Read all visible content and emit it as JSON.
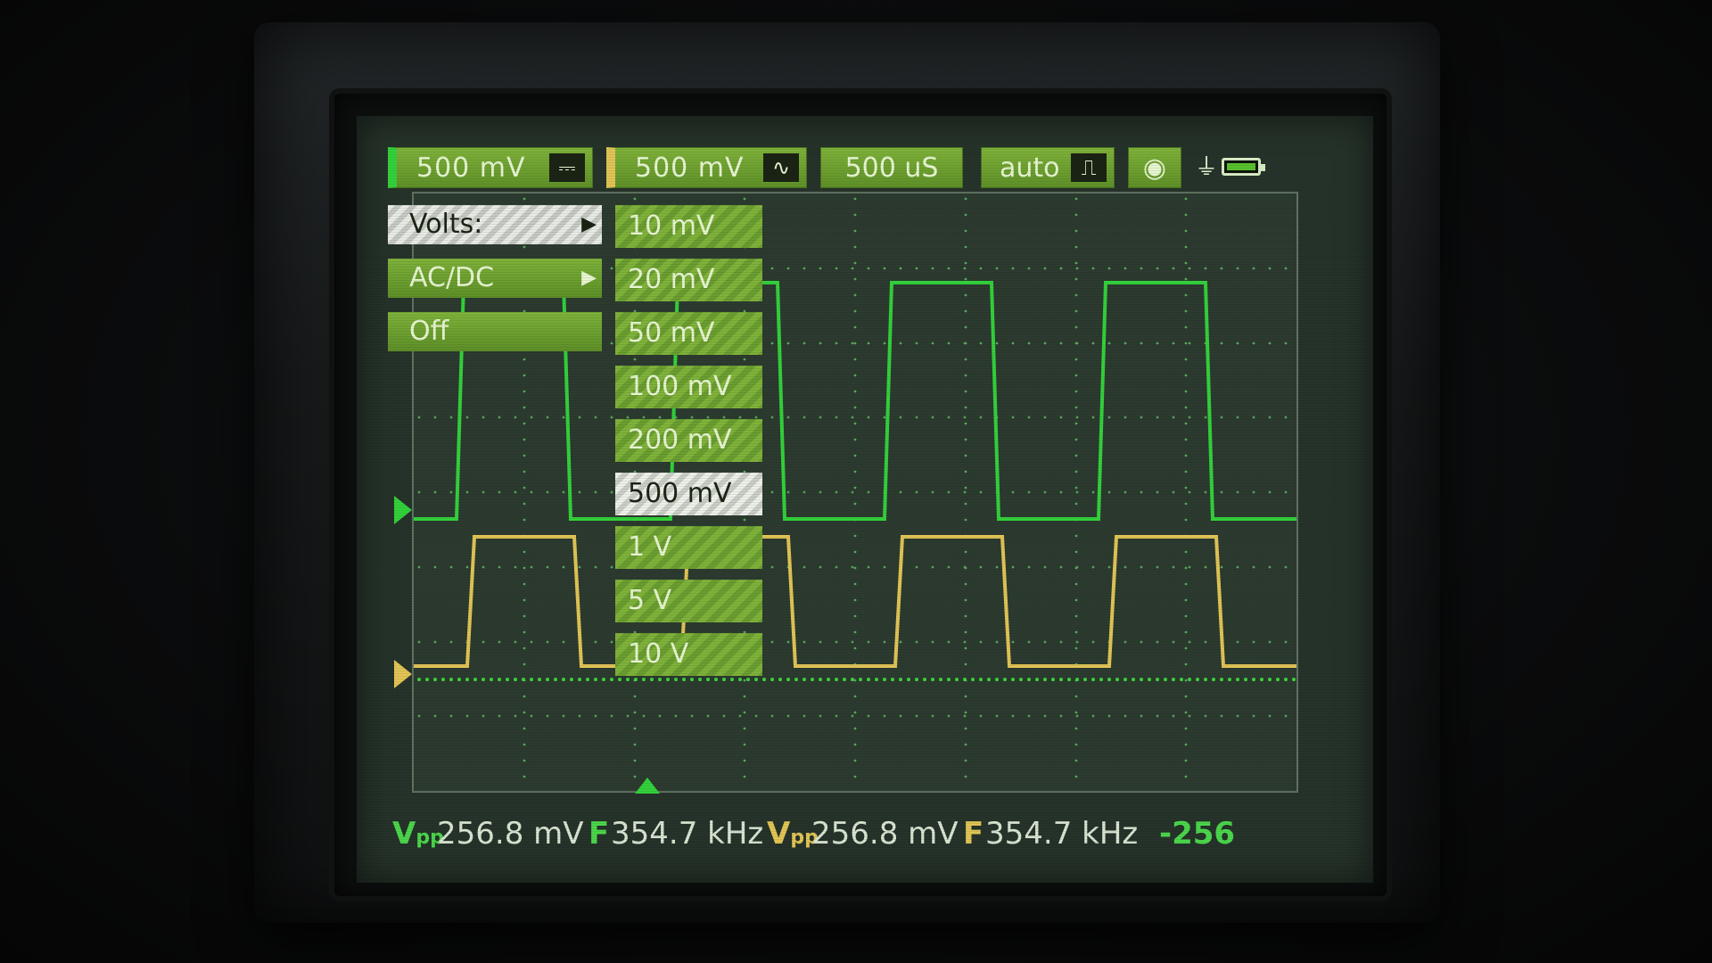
{
  "topbar": {
    "ch1_scale": "500 mV",
    "ch1_coupling_icon": "dc-coupling-icon",
    "ch2_scale": "500 mV",
    "ch2_coupling_icon": "ac-coupling-icon",
    "timebase": "500 uS",
    "trigger_mode": "auto",
    "trigger_edge_icon": "rising-edge-icon",
    "camera_icon": "camera-icon",
    "power_icon": "plug-icon",
    "battery_icon": "battery-icon"
  },
  "channel_menu": {
    "items": [
      {
        "label": "Volts:",
        "has_submenu": true,
        "selected": true
      },
      {
        "label": "AC/DC",
        "has_submenu": true,
        "selected": false
      },
      {
        "label": "Off",
        "has_submenu": false,
        "selected": false
      }
    ]
  },
  "volts_submenu": {
    "items": [
      "10 mV",
      "20 mV",
      "50 mV",
      "100 mV",
      "200 mV",
      "500 mV",
      "1 V",
      "5 V",
      "10 V"
    ],
    "selected": "500 mV"
  },
  "measurements": {
    "ch1": {
      "vpp_label": "V",
      "vpp_sub": "pp",
      "vpp_value": "256.8 mV",
      "freq_label": "F",
      "freq_value": "354.7 kHz"
    },
    "ch2": {
      "vpp_label": "V",
      "vpp_sub": "pp",
      "vpp_value": "256.8 mV",
      "freq_label": "F",
      "freq_value": "354.7 kHz"
    },
    "offset": "-256"
  },
  "colors": {
    "ch1": "#33d13b",
    "ch2": "#e1c456",
    "menu_green": "#7fb23a",
    "screen_bg": "#2c3a2f"
  }
}
